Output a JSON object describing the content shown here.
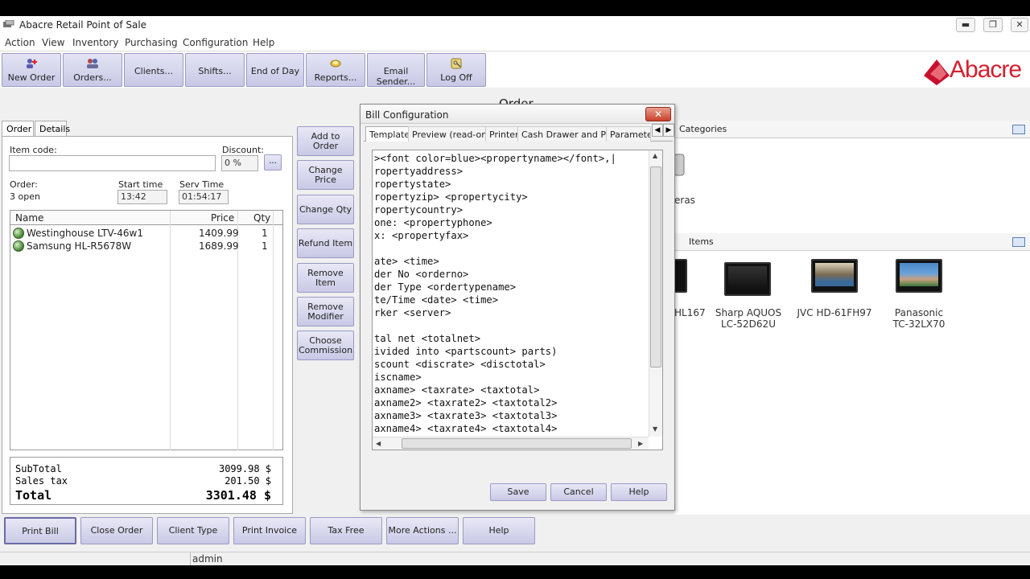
{
  "window": {
    "title": "Abacre Retail Point of Sale",
    "minimize": "▬",
    "maximize": "❐",
    "close": "✕"
  },
  "menu": [
    "Action",
    "View",
    "Inventory",
    "Purchasing",
    "Configuration",
    "Help"
  ],
  "toolbar": {
    "buttons": [
      "New Order",
      "Orders...",
      "Clients...",
      "Shifts...",
      "End of Day",
      "Reports...",
      "Email Sender...",
      "Log Off"
    ],
    "logo": "Abacre"
  },
  "order_heading": "Order",
  "order_panel": {
    "tabs": [
      "Order",
      "Details"
    ],
    "item_code_label": "Item code:",
    "item_code_value": "",
    "discount_label": "Discount:",
    "discount_value": "0 %",
    "dots_button": "...",
    "order_label": "Order:",
    "order_value": "3 open",
    "start_time_label": "Start time",
    "start_time_value": "13:42",
    "serv_time_label": "Serv Time",
    "serv_time_value": "01:54:17",
    "columns": [
      "Name",
      "Price",
      "Qty"
    ],
    "items": [
      {
        "name": "Westinghouse LTV-46w1",
        "price": "1409.99",
        "qty": "1"
      },
      {
        "name": "Samsung HL-R5678W",
        "price": "1689.99",
        "qty": "1"
      }
    ],
    "totals": {
      "subtotal_label": "SubTotal",
      "subtotal_value": "3099.98 $",
      "tax_label": "Sales tax",
      "tax_value": "201.50 $",
      "total_label": "Total",
      "total_value": "3301.48 $"
    }
  },
  "actions": [
    "Add to Order",
    "Change Price",
    "Change Qty",
    "Refund Item",
    "Remove Item",
    "Remove Modifier",
    "Choose Commission"
  ],
  "right_panel": {
    "categories_label": "Categories",
    "category_partial": "eras",
    "items_label": "Items",
    "products": [
      {
        "name": "HL167",
        "partial": true
      },
      {
        "name": "Sharp AQUOS LC-52D62U"
      },
      {
        "name": "JVC HD-61FH97"
      },
      {
        "name": "Panasonic TC-32LX70"
      }
    ]
  },
  "dialog": {
    "title": "Bill Configuration",
    "close": "✕",
    "tabs": [
      "Template",
      "Preview (read-only)",
      "Printer",
      "Cash Drawer and Pole",
      "Parameters"
    ],
    "code_lines": [
      "><font color=blue><propertyname></font>,|",
      "ropertyaddress>",
      "ropertystate>",
      "ropertyzip> <propertycity>",
      "ropertycountry>",
      "one: <propertyphone>",
      "x: <propertyfax>",
      "",
      "ate> <time>",
      "der No <orderno>",
      "der Type <ordertypename>",
      "te/Time <date> <time>",
      "rker <server>",
      "",
      "tal net <totalnet>",
      "ivided into <partscount> parts)",
      "scount <discrate> <disctotal>",
      "iscname>",
      "axname> <taxrate> <taxtotal>",
      "axname2> <taxrate2> <taxtotal2>",
      "axname3> <taxrate3> <taxtotal3>",
      "axname4> <taxrate4> <taxtotal4>"
    ],
    "buttons": [
      "Save",
      "Cancel",
      "Help"
    ]
  },
  "bottom_buttons": [
    "Print Bill",
    "Close Order",
    "Client Type",
    "Print Invoice",
    "Tax Free",
    "More Actions ...",
    "Help"
  ],
  "status": {
    "user": "admin"
  }
}
